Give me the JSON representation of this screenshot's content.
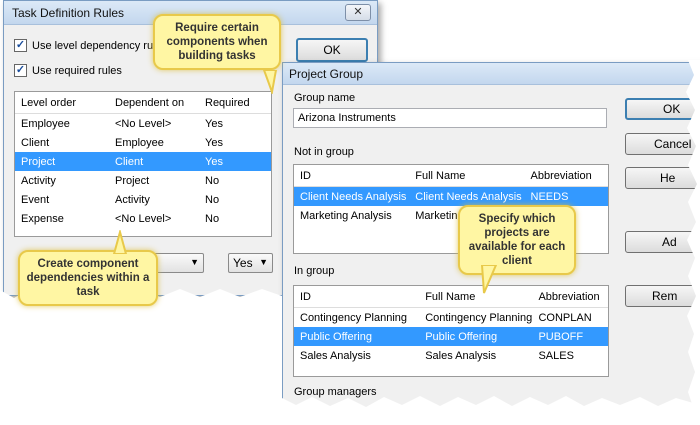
{
  "tdr": {
    "title": "Task Definition Rules",
    "close_glyph": "✕",
    "check_level_dep": "Use level dependency rules",
    "check_required": "Use required rules",
    "ok": "OK",
    "columns": [
      "Level order",
      "Dependent on",
      "Required"
    ],
    "rows": [
      [
        "Employee",
        "<No Level>",
        "Yes"
      ],
      [
        "Client",
        "Employee",
        "Yes"
      ],
      [
        "Project",
        "Client",
        "Yes"
      ],
      [
        "Activity",
        "Project",
        "No"
      ],
      [
        "Event",
        "Activity",
        "No"
      ],
      [
        "Expense",
        "<No Level>",
        "No"
      ]
    ],
    "selected_row": 2,
    "required_combo_value": "Yes"
  },
  "pg": {
    "title": "Project Group",
    "group_name_label": "Group name",
    "group_name_value": "Arizona Instruments",
    "not_in_group_label": "Not in group",
    "in_group_label": "In group",
    "group_managers_label": "Group managers",
    "columns": [
      "ID",
      "Full Name",
      "Abbreviation"
    ],
    "not_in_group_rows": [
      [
        "Client Needs Analysis",
        "Client Needs Analysis",
        "NEEDS"
      ],
      [
        "Marketing Analysis",
        "Marketing",
        ""
      ]
    ],
    "in_group_rows": [
      [
        "Contingency Planning",
        "Contingency Planning",
        "CONPLAN"
      ],
      [
        "Public Offering",
        "Public Offering",
        "PUBOFF"
      ],
      [
        "Sales Analysis",
        "Sales Analysis",
        "SALES"
      ]
    ],
    "buttons": [
      "OK",
      "Cancel",
      "He",
      "Ad",
      "Rem"
    ]
  },
  "callouts": {
    "top": "Require certain components when building tasks",
    "left": "Create component dependencies within a task",
    "middle": "Specify which projects are available for each client"
  },
  "colors": {
    "selection": "#3399ff",
    "callout_fill": "#fff6a3",
    "callout_border": "#e8c94a"
  }
}
